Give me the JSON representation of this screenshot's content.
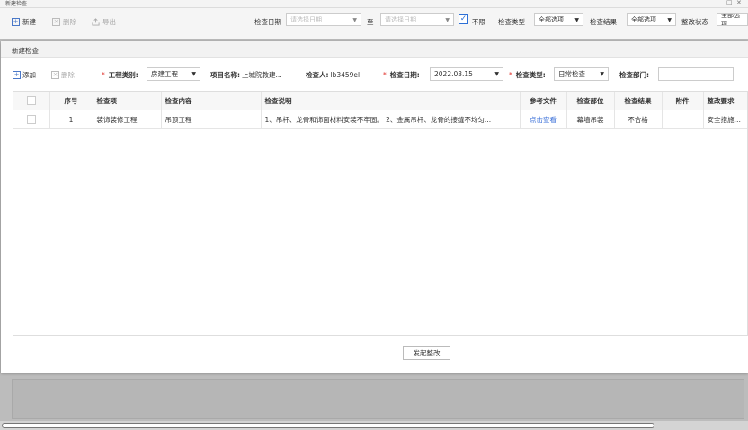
{
  "window": {
    "title": "新建检查",
    "minimize_glyph": "□",
    "close_glyph": "✕"
  },
  "background_toolbar": {
    "new_label": "新建",
    "delete_label": "删除",
    "export_label": "导出",
    "check_date_label": "检查日期",
    "date_from_placeholder": "请选择日期",
    "to_label": "至",
    "date_to_placeholder": "请选择日期",
    "no_limit_label": "不限",
    "no_limit_checked": true,
    "check_type_label": "检查类型",
    "check_type_value": "全部选项",
    "check_result_label": "检查结果",
    "check_result_value": "全部选项",
    "rectify_status_label": "整改状态",
    "rectify_status_value": "全部选项"
  },
  "modal": {
    "title": "新建检查",
    "toolbar": {
      "add_label": "添加",
      "delete_label": "删除",
      "project_category_label": "工程类别:",
      "project_category_value": "房建工程",
      "project_name_label": "项目名称:",
      "project_name_value": "上城院教建...",
      "inspector_label": "检查人:",
      "inspector_value": "lb3459el",
      "check_date_label": "检查日期:",
      "check_date_value": "2022.03.15",
      "check_type_label": "检查类型:",
      "check_type_value": "日常检查",
      "check_dept_label": "检查部门:",
      "check_dept_value": ""
    },
    "table": {
      "headers": {
        "index": "序号",
        "item": "检查项",
        "content": "检查内容",
        "description": "检查说明",
        "ref_file": "参考文件",
        "location": "检查部位",
        "result": "检查结果",
        "attachment": "附件",
        "requirement": "整改要求"
      },
      "rows": [
        {
          "index": "1",
          "item": "装饰装修工程",
          "content": "吊顶工程",
          "description": "1、吊杆、龙骨和饰面材料安装不牢固。 2、金属吊杆、龙骨的接缝不均匀...",
          "ref_file": "点击查看",
          "location": "幕墙吊装",
          "result": "不合格",
          "attachment": "",
          "requirement": "安全措施未到位"
        }
      ]
    },
    "submit_label": "发起整改"
  },
  "icons": {
    "add": "plus-square-icon",
    "delete": "x-square-icon",
    "export": "export-icon",
    "dropdown": "caret-down-icon",
    "checkbox": "check-icon"
  },
  "colors": {
    "accent": "#2c6fd6",
    "link": "#3a6fd8",
    "required": "#e0302a",
    "overlay": "#bcbcbc"
  }
}
